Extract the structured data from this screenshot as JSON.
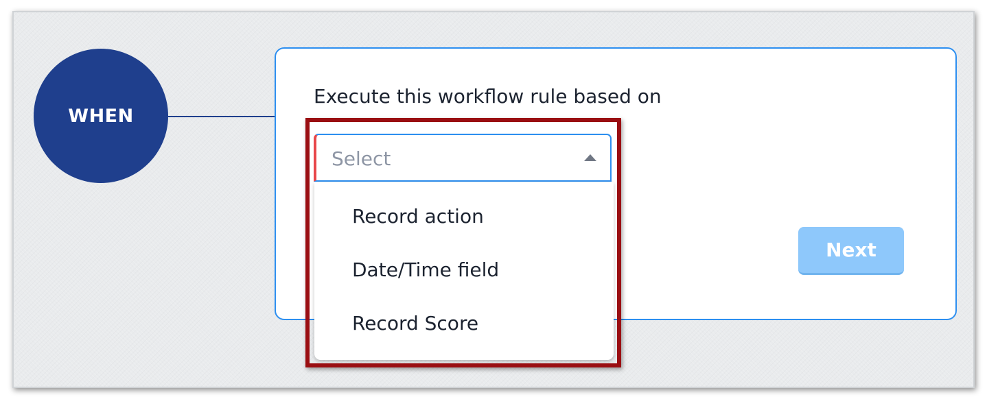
{
  "trigger": {
    "label": "WHEN",
    "color": "#1f3f8d"
  },
  "form": {
    "prompt": "Execute this workflow rule based on",
    "select": {
      "placeholder": "Select",
      "options": [
        {
          "label": "Record action"
        },
        {
          "label": "Date/Time field"
        },
        {
          "label": "Record Score"
        }
      ]
    },
    "next_label": "Next"
  },
  "colors": {
    "accent": "#2d8ff0",
    "next_button": "#8ec8fb",
    "required_marker": "#e8474a",
    "highlight_box": "#9a0e12"
  },
  "icons": {
    "select_caret": "caret-up-icon"
  }
}
